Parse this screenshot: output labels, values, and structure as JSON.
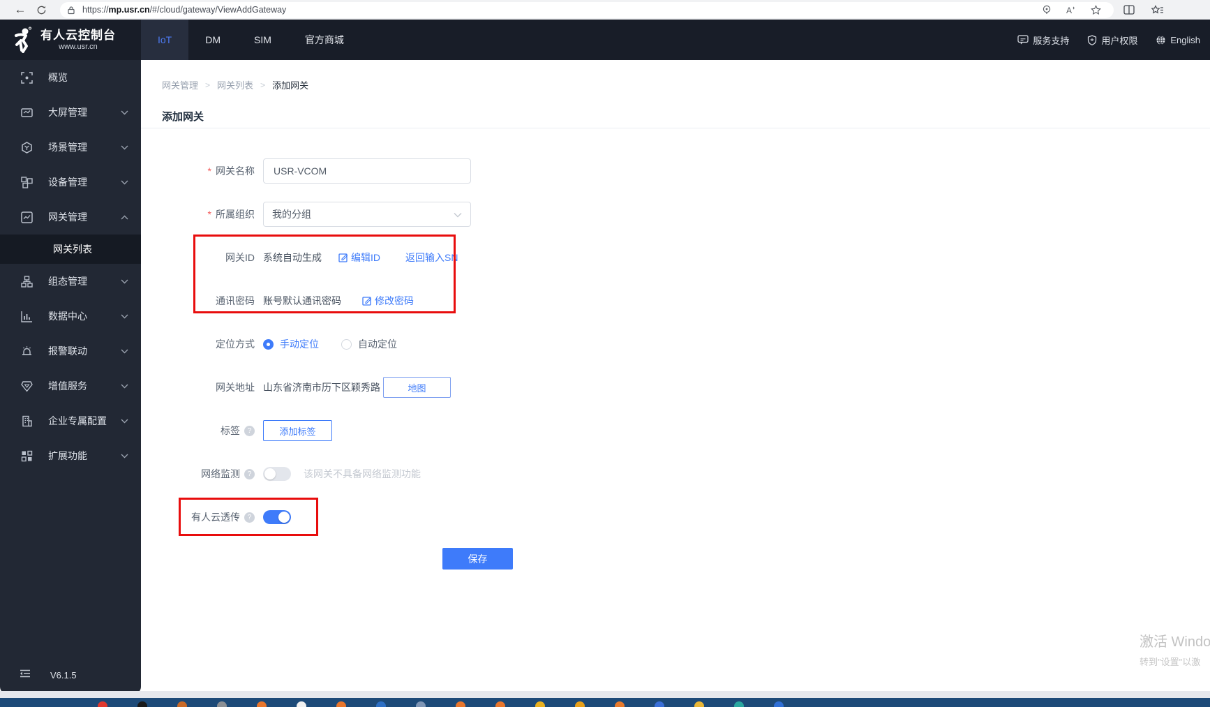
{
  "browser": {
    "url_prefix": "https://",
    "url_host": "mp.usr.cn",
    "url_path": "/#/cloud/gateway/ViewAddGateway"
  },
  "topnav": {
    "logo_title": "有人云控制台",
    "logo_sub": "www.usr.cn",
    "tabs": [
      {
        "label": "IoT"
      },
      {
        "label": "DM"
      },
      {
        "label": "SIM"
      },
      {
        "label": "官方商城"
      }
    ],
    "right": [
      {
        "label": "服务支持"
      },
      {
        "label": "用户权限"
      },
      {
        "label": "English"
      }
    ]
  },
  "sidebar": {
    "items": [
      {
        "label": "概览"
      },
      {
        "label": "大屏管理"
      },
      {
        "label": "场景管理"
      },
      {
        "label": "设备管理"
      },
      {
        "label": "网关管理",
        "children": [
          {
            "label": "网关列表"
          }
        ]
      },
      {
        "label": "组态管理"
      },
      {
        "label": "数据中心"
      },
      {
        "label": "报警联动"
      },
      {
        "label": "增值服务"
      },
      {
        "label": "企业专属配置"
      },
      {
        "label": "扩展功能"
      }
    ],
    "version": "V6.1.5"
  },
  "breadcrumb": {
    "items": [
      "网关管理",
      "网关列表",
      "添加网关"
    ]
  },
  "page": {
    "title": "添加网关"
  },
  "form": {
    "gateway_name": {
      "label": "网关名称",
      "value": "USR-VCOM"
    },
    "organization": {
      "label": "所属组织",
      "value": "我的分组"
    },
    "gateway_id": {
      "label": "网关ID",
      "value": "系统自动生成",
      "edit_link": "编辑ID",
      "sn_link": "返回输入SN"
    },
    "comm_password": {
      "label": "通讯密码",
      "value": "账号默认通讯密码",
      "edit_link": "修改密码"
    },
    "location_mode": {
      "label": "定位方式",
      "manual": "手动定位",
      "auto": "自动定位",
      "selected": "手动定位"
    },
    "gateway_address": {
      "label": "网关地址",
      "value": "山东省济南市历下区颖秀路",
      "map_button": "地图"
    },
    "tags": {
      "label": "标签",
      "add_button": "添加标签"
    },
    "network_monitor": {
      "label": "网络监测",
      "state": "off",
      "hint": "该网关不具备网络监测功能"
    },
    "cloud_passthrough": {
      "label": "有人云透传",
      "state": "on"
    },
    "save_button": "保存"
  },
  "watermark": {
    "line1": "激活 Windo",
    "line2": "转到\"设置\"以激"
  },
  "colors": {
    "accent": "#3e7bfa",
    "annotation_red": "#e80d0d",
    "nav_bg": "#181d28",
    "sidebar_bg": "#222834",
    "taskbar_bg": "#1d4a78"
  },
  "taskbar": {
    "icons": [
      "#e0392f",
      "#1a1a1a",
      "#c96a28",
      "#8b8f94",
      "#e8762c",
      "#f0f0f0",
      "#e8762c",
      "#2d6fc4",
      "#7e95b5",
      "#e8762c",
      "#e8762c",
      "#e9b01f",
      "#e8a01a",
      "#e87a2c",
      "#3a6fd8",
      "#e9b637",
      "#2aa7a0",
      "#2f6fd6"
    ]
  }
}
